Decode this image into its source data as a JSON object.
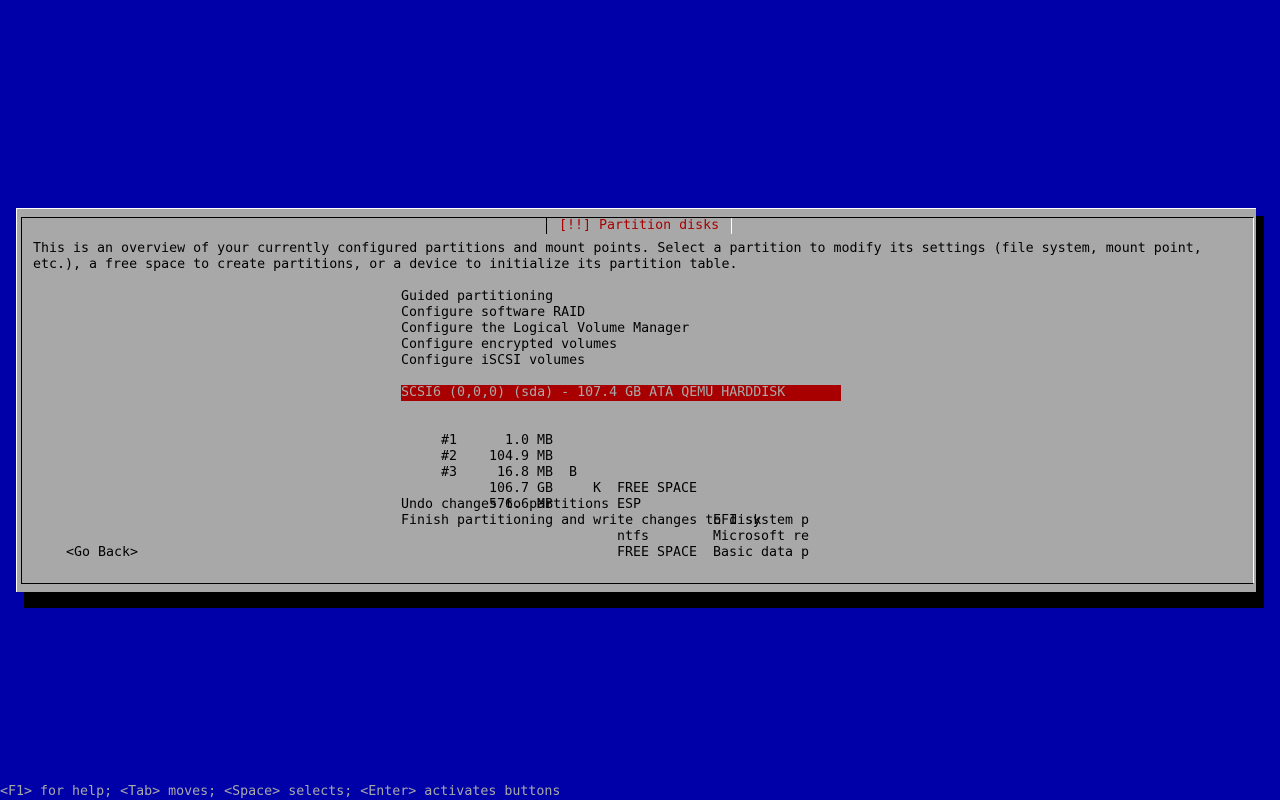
{
  "dialog": {
    "title": "[!!] Partition disks",
    "description": [
      "This is an overview of your currently configured partitions and mount points. Select a partition to modify its settings (file system, mount point,",
      "etc.), a free space to create partitions, or a device to initialize its partition table."
    ],
    "menu": [
      "Guided partitioning",
      "Configure software RAID",
      "Configure the Logical Volume Manager",
      "Configure encrypted volumes",
      "Configure iSCSI volumes"
    ],
    "disk": "SCSI6 (0,0,0) (sda) - 107.4 GB ATA QEMU HARDDISK",
    "partitions": [
      {
        "num": "",
        "size": "1.0 MB",
        "b": "",
        "k": "",
        "type": "FREE SPACE",
        "name": ""
      },
      {
        "num": "#1",
        "size": "104.9 MB",
        "b": "B",
        "k": "K",
        "type": "ESP",
        "name": "EFI system p"
      },
      {
        "num": "#2",
        "size": "16.8 MB",
        "b": "",
        "k": "",
        "type": "",
        "name": "Microsoft re"
      },
      {
        "num": "#3",
        "size": "106.7 GB",
        "b": "",
        "k": "",
        "type": "ntfs",
        "name": "Basic data p"
      },
      {
        "num": "",
        "size": "576.6 MB",
        "b": "",
        "k": "",
        "type": "FREE SPACE",
        "name": ""
      }
    ],
    "actions": [
      "Undo changes to partitions",
      "Finish partitioning and write changes to disk"
    ],
    "go_back": "<Go Back>"
  },
  "status_bar": "<F1> for help; <Tab> moves; <Space> selects; <Enter> activates buttons",
  "colors": {
    "background": "#0000a8",
    "dialog": "#a8a8a8",
    "title": "#a80000",
    "selection": "#a80000"
  }
}
